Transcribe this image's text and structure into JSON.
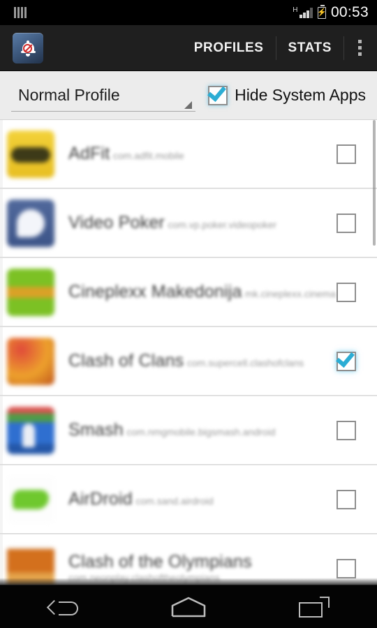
{
  "status_bar": {
    "sim_icon": "sim-bars-icon",
    "network_type": "H",
    "signal_icon": "signal-bars-icon",
    "battery_icon": "battery-charging-icon",
    "time": "00:53"
  },
  "action_bar": {
    "app_icon": "bell-blocked-icon",
    "tabs": [
      {
        "label": "PROFILES",
        "name": "tab-profiles"
      },
      {
        "label": "STATS",
        "name": "tab-stats"
      }
    ],
    "overflow_icon": "overflow-menu-icon"
  },
  "profile_bar": {
    "spinner_value": "Normal Profile",
    "spinner_arrow_icon": "dropdown-triangle-icon",
    "hide_system_apps_label": "Hide System Apps",
    "hide_system_apps_checked": true
  },
  "app_list": [
    {
      "name": "AdFit",
      "package": "com.adfit.mobile",
      "checked": false,
      "icon": "app-icon-yellow"
    },
    {
      "name": "Video Poker",
      "package": "com.vp.poker.videopoker",
      "checked": false,
      "icon": "app-icon-blue"
    },
    {
      "name": "Cineplexx Makedonija",
      "package": "mk.cineplexx.cinema",
      "checked": false,
      "icon": "app-icon-green"
    },
    {
      "name": "Clash of Clans",
      "package": "com.supercell.clashofclans",
      "checked": true,
      "icon": "app-icon-red"
    },
    {
      "name": "Smash",
      "package": "com.nmgmobile.bigsmash.android",
      "checked": false,
      "icon": "app-icon-rainbow"
    },
    {
      "name": "AirDroid",
      "package": "com.sand.airdroid",
      "checked": false,
      "icon": "app-icon-airdroid"
    },
    {
      "name": "Clash of the Olympians",
      "package": "com.neonplay.clashoftheolympians",
      "checked": false,
      "icon": "app-icon-orange"
    }
  ],
  "nav_bar": {
    "back_icon": "back-arrow-icon",
    "home_icon": "home-icon",
    "recents_icon": "recent-apps-icon"
  },
  "colors": {
    "accent": "#2badd4",
    "action_bar_bg": "#1f1f1f",
    "list_bg": "#e7e7e7"
  }
}
